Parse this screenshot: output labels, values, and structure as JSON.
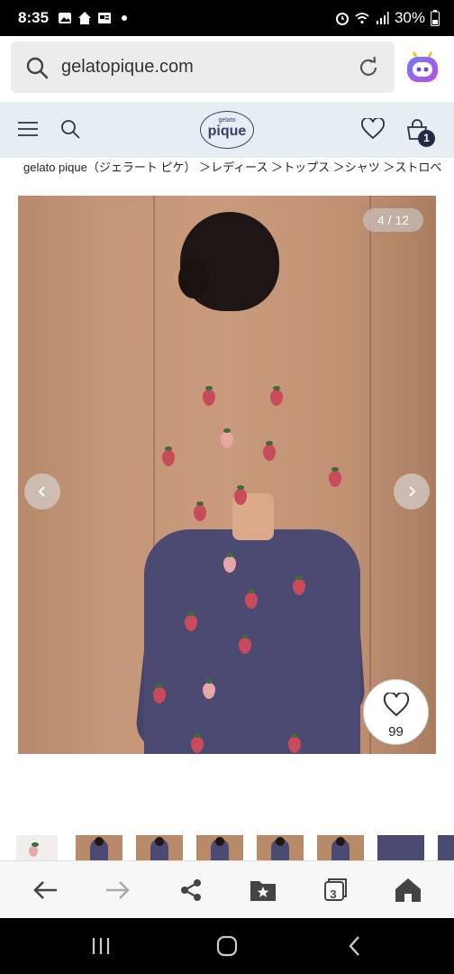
{
  "status_bar": {
    "time": "8:35",
    "battery": "30%",
    "left_icons": [
      "gallery-icon",
      "home-notification-icon",
      "news-icon",
      "dot-icon"
    ],
    "right_icons": [
      "alarm-icon",
      "wifi-icon",
      "signal-icon",
      "battery-icon"
    ]
  },
  "browser": {
    "url": "gelatopique.com",
    "tab_count": "3"
  },
  "site_header": {
    "logo_small": "gelato",
    "logo_big": "pique",
    "cart_count": "1"
  },
  "breadcrumb": "gelato pique（ジェラート ピケ） ＞レディース ＞トップス ＞シャツ ＞ストロベ",
  "gallery": {
    "counter": "4 / 12",
    "favorite_count": "99"
  },
  "colors": {
    "header_bg": "#e6edf3",
    "accent_navy": "#222a4a",
    "url_bar_bg": "#ececee"
  }
}
